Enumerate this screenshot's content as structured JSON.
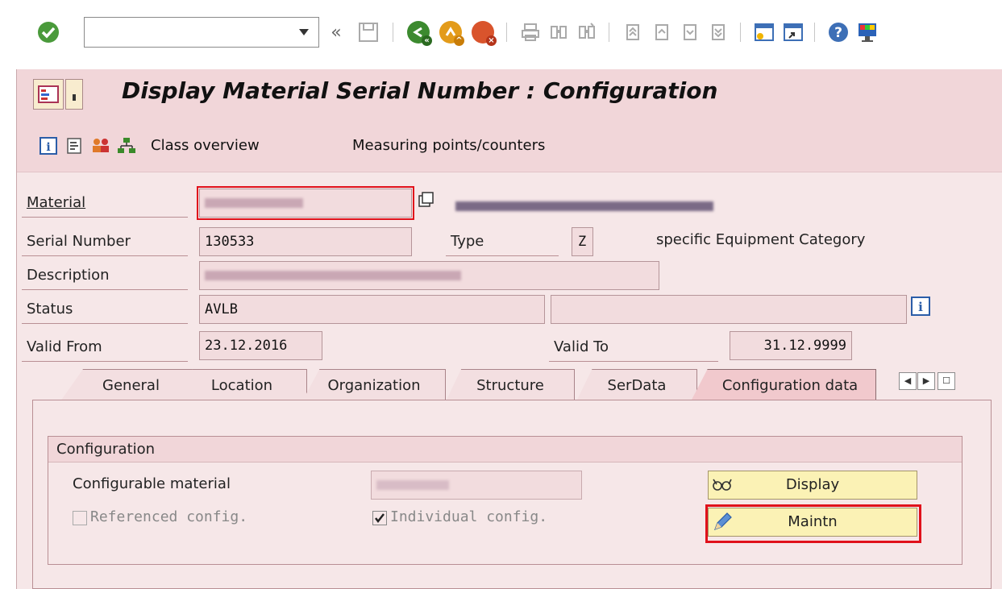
{
  "toolbar": {
    "command_field_value": "",
    "icons": [
      "enter-icon",
      "back-double-icon",
      "save-icon",
      "back-icon",
      "exit-icon",
      "cancel-icon",
      "print-icon",
      "find-icon",
      "find-next-icon",
      "first-page-icon",
      "previous-page-icon",
      "next-page-icon",
      "last-page-icon",
      "create-session-icon",
      "shortcut-icon",
      "help-icon",
      "customize-layout-icon"
    ]
  },
  "title": "Display Material Serial Number : Configuration",
  "app_toolbar": {
    "class_overview": "Class overview",
    "measuring_points": "Measuring points/counters"
  },
  "form": {
    "material_label": "Material",
    "serial_label": "Serial Number",
    "serial_value": "130533",
    "type_label": "Type",
    "type_value": "Z",
    "type_text": "specific Equipment Category",
    "description_label": "Description",
    "status_label": "Status",
    "status_value": "AVLB",
    "status_value2": "",
    "valid_from_label": "Valid From",
    "valid_from_value": "23.12.2016",
    "valid_to_label": "Valid To",
    "valid_to_value": "31.12.9999"
  },
  "tabs": [
    {
      "label": "General"
    },
    {
      "label": "Location"
    },
    {
      "label": "Organization"
    },
    {
      "label": "Structure"
    },
    {
      "label": "SerData"
    },
    {
      "label": "Configuration data",
      "active": true
    }
  ],
  "configuration": {
    "group_title": "Configuration",
    "configurable_label": "Configurable material",
    "referenced_label": "Referenced config.",
    "individual_label": "Individual config.",
    "referenced_checked": false,
    "individual_checked": true,
    "display_button": "Display",
    "maintain_button": "Maintn"
  },
  "colors": {
    "accent_highlight": "#e0111b",
    "title_bar": "#f1d6d9",
    "button_yellow": "#fbf2b5"
  }
}
